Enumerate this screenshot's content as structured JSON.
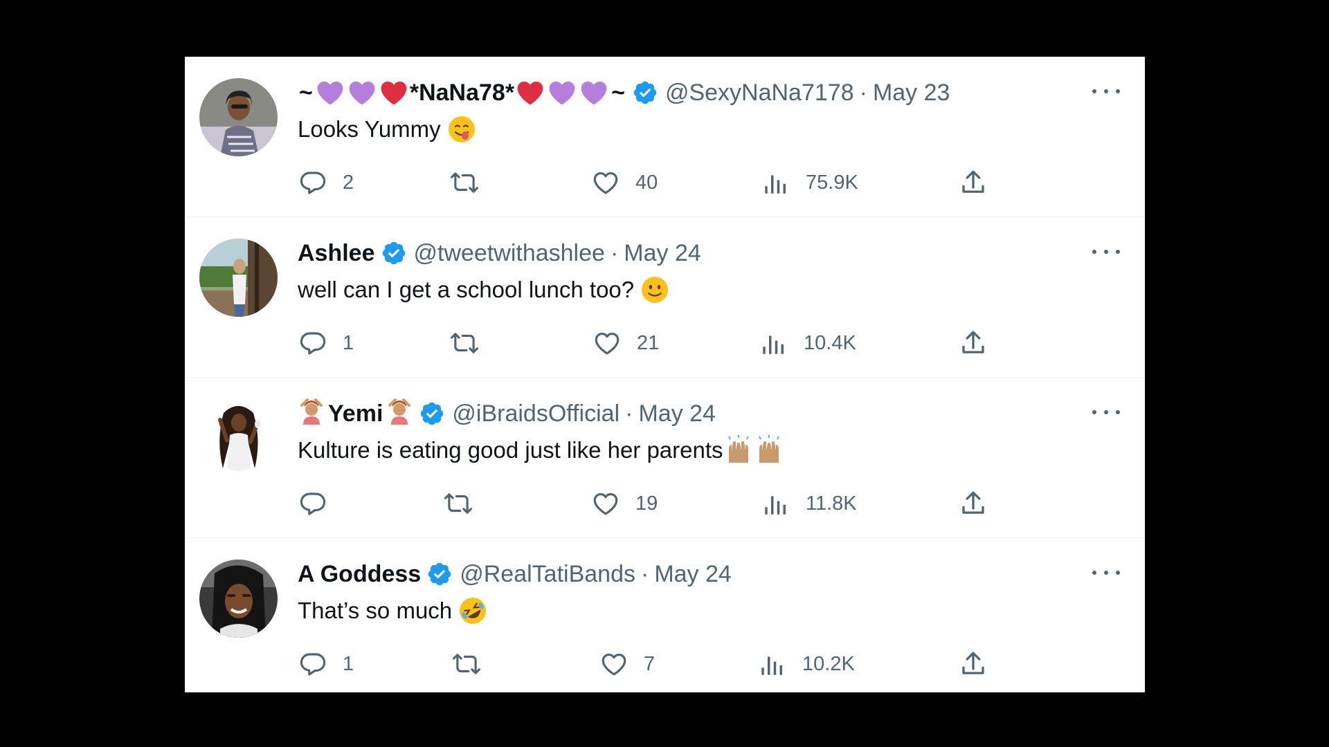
{
  "tweets": [
    {
      "display_name": "*NaNa78*",
      "name_prefix": "~",
      "name_suffix": "~",
      "handle": "@SexyNaNa7178",
      "separator": "·",
      "date": "May 23",
      "text": "Looks Yummy",
      "text_emoji": "savoring-food-emoji",
      "replies": "2",
      "retweets": "",
      "likes": "40",
      "views": "75.9K"
    },
    {
      "display_name": "Ashlee",
      "handle": "@tweetwithashlee",
      "separator": "·",
      "date": "May 24",
      "text": "well can I get a school lunch too?",
      "text_emoji": "slightly-smiling-emoji",
      "replies": "1",
      "retweets": "",
      "likes": "21",
      "views": "10.4K"
    },
    {
      "display_name": "Yemi",
      "handle": "@iBraidsOfficial",
      "separator": "·",
      "date": "May 24",
      "text": "Kulture is eating good just like her parents",
      "text_emoji": "raising-hands-emoji",
      "replies": "",
      "retweets": "",
      "likes": "19",
      "views": "11.8K"
    },
    {
      "display_name": "A Goddess",
      "handle": "@RealTatiBands",
      "separator": "·",
      "date": "May 24",
      "text": "That’s so much",
      "text_emoji": "rolling-on-floor-laughing-emoji",
      "replies": "1",
      "retweets": "",
      "likes": "7",
      "views": "10.2K"
    }
  ],
  "colors": {
    "text": "#0f1419",
    "secondary": "#536471",
    "verified": "#1d9bf0",
    "purple_heart": "#b57edc",
    "red_heart": "#dd2e44"
  },
  "icons": [
    "reply-icon",
    "retweet-icon",
    "like-icon",
    "views-icon",
    "share-icon",
    "more-icon",
    "verified-badge-icon"
  ]
}
